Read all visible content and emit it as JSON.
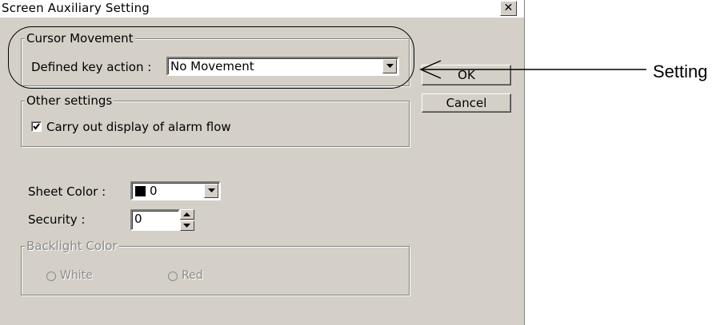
{
  "window": {
    "title": "Screen Auxiliary Setting",
    "close_glyph": "✕"
  },
  "cursor_movement": {
    "legend": "Cursor Movement",
    "label": "Defined key action :",
    "value": "No Movement"
  },
  "other_settings": {
    "legend": "Other settings",
    "checkbox_label": "Carry out display of alarm flow",
    "checked": true
  },
  "sheet_color": {
    "label": "Sheet Color :",
    "value": "0",
    "swatch_color": "#000000"
  },
  "security": {
    "label": "Security :",
    "value": "0"
  },
  "backlight": {
    "legend": "Backlight Color",
    "options": [
      "White",
      "Red"
    ],
    "enabled": false
  },
  "buttons": {
    "ok": "OK",
    "cancel": "Cancel"
  },
  "annotation": {
    "text": "Setting"
  },
  "colors": {
    "dialog_bg": "#d4d0c8",
    "disabled_text": "#8a8a8a"
  }
}
